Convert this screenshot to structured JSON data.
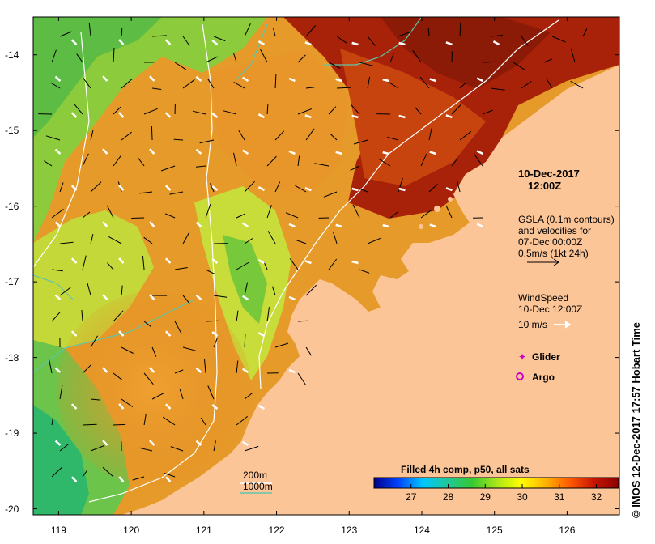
{
  "map": {
    "lon_ticks": [
      "119",
      "120",
      "121",
      "122",
      "123",
      "124",
      "125",
      "126"
    ],
    "lat_ticks": [
      "-14",
      "-15",
      "-16",
      "-17",
      "-18",
      "-19",
      "-20"
    ],
    "lon_range": [
      118.65,
      126.72
    ],
    "lat_range": [
      -20.08,
      -13.5
    ],
    "colors": {
      "land": "#fcc597",
      "frame": "#000000",
      "contour_200m": "#ffffff",
      "contour_1000m": "#5fc6a8",
      "glider": "#cc00cc",
      "argo": "#cc00cc"
    }
  },
  "annotations": {
    "date": "10-Dec-2017",
    "time": "12:00Z",
    "gsla_line1": "GSLA (0.1m contours)",
    "gsla_line2": "and velocities for",
    "gsla_line3": "07-Dec 00:00Z",
    "gsla_line4": "0.5m/s (1kt 24h)",
    "wind_line1": "WindSpeed",
    "wind_line2": "10-Dec 12:00Z",
    "wind_scale": "10 m/s"
  },
  "legend": {
    "glider_label": "Glider",
    "argo_label": "Argo",
    "depth_200": "200m",
    "depth_1000": "1000m"
  },
  "colorbar": {
    "title": "Filled 4h comp, p50, all sats",
    "ticks": [
      "27",
      "28",
      "29",
      "30",
      "31",
      "32"
    ],
    "min": 26.0,
    "max": 32.6,
    "stops": [
      "#00008b",
      "#0044ff",
      "#00c8ff",
      "#1fc89a",
      "#35c832",
      "#a8e61a",
      "#ffff00",
      "#ffb400",
      "#ff5a00",
      "#c81400",
      "#8b0000"
    ]
  },
  "credit": "© IMOS 12-Dec-2017 17:57 Hobart Time"
}
